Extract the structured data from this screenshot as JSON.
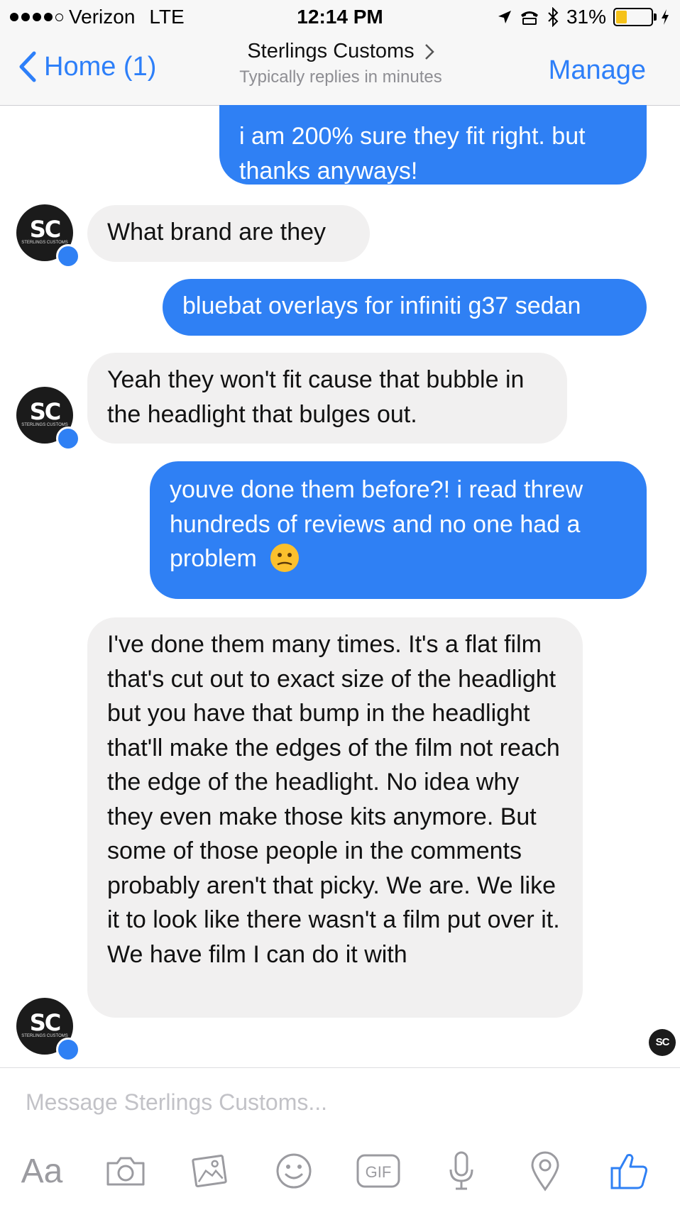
{
  "status_bar": {
    "carrier": "Verizon",
    "network": "LTE",
    "time": "12:14 PM",
    "battery": "31%",
    "battery_level": 0.31
  },
  "nav": {
    "back_label": "Home (1)",
    "title": "Sterlings Customs",
    "subtitle": "Typically replies in minutes",
    "manage_label": "Manage"
  },
  "messages": [
    {
      "from": "me",
      "text": "i am 200% sure they fit right. but thanks anyways!"
    },
    {
      "from": "them",
      "text": "What brand are they"
    },
    {
      "from": "me",
      "text": "bluebat overlays for infiniti g37 sedan"
    },
    {
      "from": "them",
      "text": "Yeah they won't fit cause that bubble in the headlight that bulges out."
    },
    {
      "from": "me",
      "text": "youve done them before?! i read threw hundreds of reviews and no one had a problem",
      "emoji": "confused-face"
    },
    {
      "from": "them",
      "text": "I've done them many times. It's a flat film that's cut out to exact size of the headlight but you have that bump in the headlight that'll make the edges of the film not reach the edge of the headlight. No idea why they even make those kits anymore. But some of those people in the comments probably aren't that picky. We are. We like it to look like there wasn't a film put over it. We have film I can do it with"
    }
  ],
  "avatar_logo": "SC",
  "avatar_logo_sub": "STERLINGS CUSTOMS",
  "composer": {
    "placeholder": "Message Sterlings Customs...",
    "aa_label": "Aa",
    "gif_label": "GIF"
  },
  "icons": [
    "chevron-left-icon",
    "chevron-right-icon",
    "messenger-badge-icon",
    "camera-icon",
    "photo-icon",
    "smiley-icon",
    "gif-icon",
    "microphone-icon",
    "location-icon",
    "thumbs-up-icon"
  ],
  "colors": {
    "accent": "#2f80f4",
    "incoming_bubble": "#f1f0f0",
    "outgoing_bubble": "#2f80f4",
    "placeholder": "#c2c2c7",
    "icon_gray": "#9b9ba0"
  }
}
